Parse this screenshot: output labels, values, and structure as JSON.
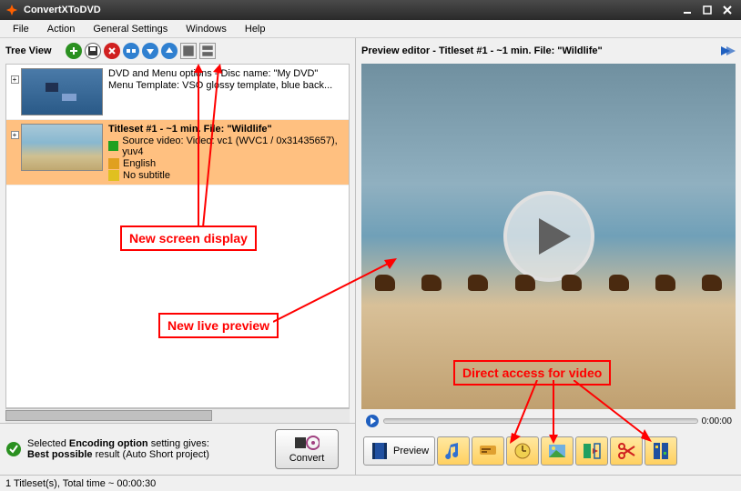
{
  "window": {
    "title": "ConvertXToDVD"
  },
  "menu": {
    "file": "File",
    "action": "Action",
    "general": "General Settings",
    "windows": "Windows",
    "help": "Help"
  },
  "treeview": {
    "label": "Tree View"
  },
  "dvdmenu": {
    "line1": "DVD and Menu options - Disc name: \"My DVD\"",
    "line2": "Menu Template: VSO glossy template, blue back..."
  },
  "titleset": {
    "title": "Titleset #1 - ~1 min. File: \"Wildlife\"",
    "source": "Source video: Video: vc1 (WVC1 / 0x31435657), yuv4",
    "lang": "English",
    "sub": "No subtitle"
  },
  "status": {
    "icon": "check",
    "line1a": "Selected ",
    "line1b": "Encoding option",
    "line1c": " setting gives:",
    "line2a": "Best possible",
    "line2b": " result (Auto Short project)"
  },
  "convert": "Convert",
  "statusbar": "1 Titleset(s), Total time ~ 00:00:30",
  "preview": {
    "title": "Preview editor - Titleset #1 - ~1 min. File: \"Wildlife\"",
    "time": "0:00:00",
    "tab_preview": "Preview"
  },
  "annotations": {
    "a1": "New screen display",
    "a2": "New live preview",
    "a3": "Direct access for video"
  }
}
